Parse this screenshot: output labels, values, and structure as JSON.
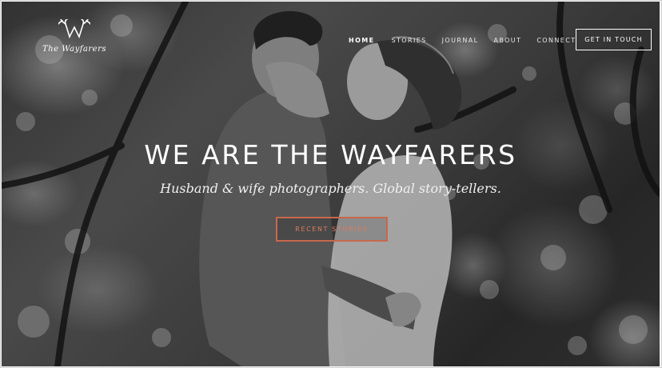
{
  "brand": {
    "logo_icon": "antler-w-icon",
    "name": "The Wayfarers"
  },
  "nav": {
    "items": [
      {
        "label": "HOME",
        "active": true
      },
      {
        "label": "STORIES",
        "active": false
      },
      {
        "label": "JOURNAL",
        "active": false
      },
      {
        "label": "ABOUT",
        "active": false
      },
      {
        "label": "CONNECT",
        "active": false
      }
    ],
    "cta_label": "GET IN TOUCH"
  },
  "hero": {
    "headline": "WE ARE THE WAYFARERS",
    "tagline": "Husband & wife photographers. Global story-tellers.",
    "cta_label": "RECENT STORIES",
    "cta_color": "#c8674d",
    "photo": "black-and-white-couple-embracing-in-forest"
  }
}
